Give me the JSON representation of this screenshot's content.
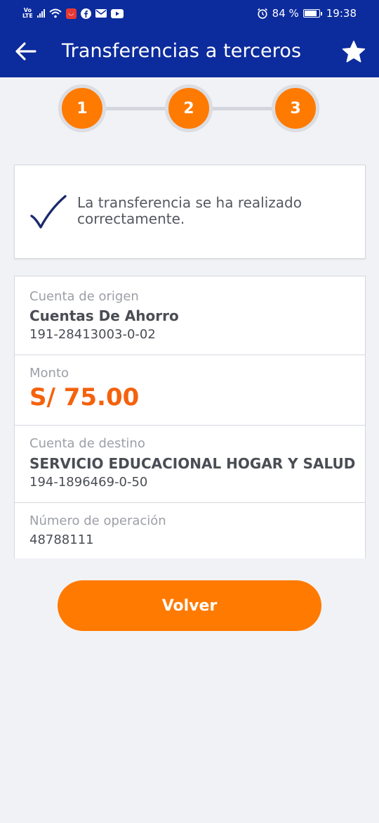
{
  "status_bar": {
    "network_top": "Vo",
    "network_bottom": "LTE",
    "battery": "84 %",
    "time": "19:38"
  },
  "header": {
    "title": "Transferencias a terceros"
  },
  "stepper": {
    "steps": [
      "1",
      "2",
      "3"
    ]
  },
  "confirmation": {
    "message": "La transferencia se ha realizado correctamente."
  },
  "details": {
    "origin": {
      "label": "Cuenta de origen",
      "name": "Cuentas De Ahorro",
      "number": "191-28413003-0-02"
    },
    "amount": {
      "label": "Monto",
      "value": "S/ 75.00"
    },
    "destination": {
      "label": "Cuenta de destino",
      "name": "SERVICIO EDUCACIONAL HOGAR Y SALUD",
      "number": "194-1896469-0-50"
    },
    "operation": {
      "label": "Número de operación",
      "value": "48788111"
    }
  },
  "actions": {
    "back_label": "Volver"
  },
  "colors": {
    "primary": "#0c2b9c",
    "accent": "#ff7a00",
    "amount": "#f4620c",
    "background": "#f1f2f6"
  }
}
